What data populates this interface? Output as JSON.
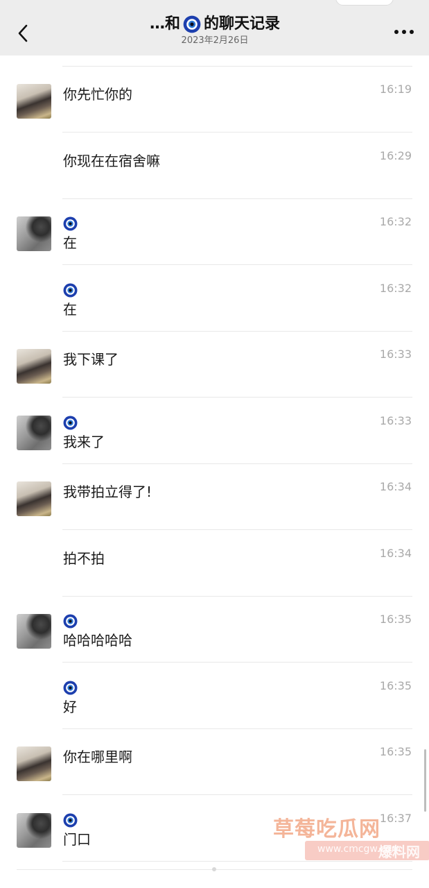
{
  "header": {
    "title_prefix": "…和",
    "title_suffix": "的聊天记录",
    "date": "2023年2月26日",
    "back_icon": "chevron-left-icon",
    "more_icon": "more-dots-icon"
  },
  "messages": [
    {
      "sender": "girl",
      "show_avatar": true,
      "show_name_icon": false,
      "time": "16:19",
      "text": "你先忙你的"
    },
    {
      "sender": "girl",
      "show_avatar": false,
      "show_name_icon": false,
      "time": "16:29",
      "text": "你现在在宿舍嘛"
    },
    {
      "sender": "cat",
      "show_avatar": true,
      "show_name_icon": true,
      "time": "16:32",
      "text": "在"
    },
    {
      "sender": "cat",
      "show_avatar": false,
      "show_name_icon": true,
      "time": "16:32",
      "text": "在"
    },
    {
      "sender": "girl",
      "show_avatar": true,
      "show_name_icon": false,
      "time": "16:33",
      "text": "我下课了"
    },
    {
      "sender": "cat",
      "show_avatar": true,
      "show_name_icon": true,
      "time": "16:33",
      "text": "我来了"
    },
    {
      "sender": "girl",
      "show_avatar": true,
      "show_name_icon": false,
      "time": "16:34",
      "text": "我带拍立得了!"
    },
    {
      "sender": "girl",
      "show_avatar": false,
      "show_name_icon": false,
      "time": "16:34",
      "text": "拍不拍"
    },
    {
      "sender": "cat",
      "show_avatar": true,
      "show_name_icon": true,
      "time": "16:35",
      "text": "哈哈哈哈哈"
    },
    {
      "sender": "cat",
      "show_avatar": false,
      "show_name_icon": true,
      "time": "16:35",
      "text": "好"
    },
    {
      "sender": "girl",
      "show_avatar": true,
      "show_name_icon": false,
      "time": "16:35",
      "text": "你在哪里啊"
    },
    {
      "sender": "cat",
      "show_avatar": true,
      "show_name_icon": true,
      "time": "16:37",
      "text": "门口"
    }
  ],
  "watermark": {
    "line1": "草莓吃瓜网",
    "line2": "www.cmcgw.com",
    "line3": "爆料网"
  },
  "colors": {
    "header_bg": "#ededed",
    "eye_blue": "#1d3fae",
    "time_gray": "#a9a9a9"
  }
}
